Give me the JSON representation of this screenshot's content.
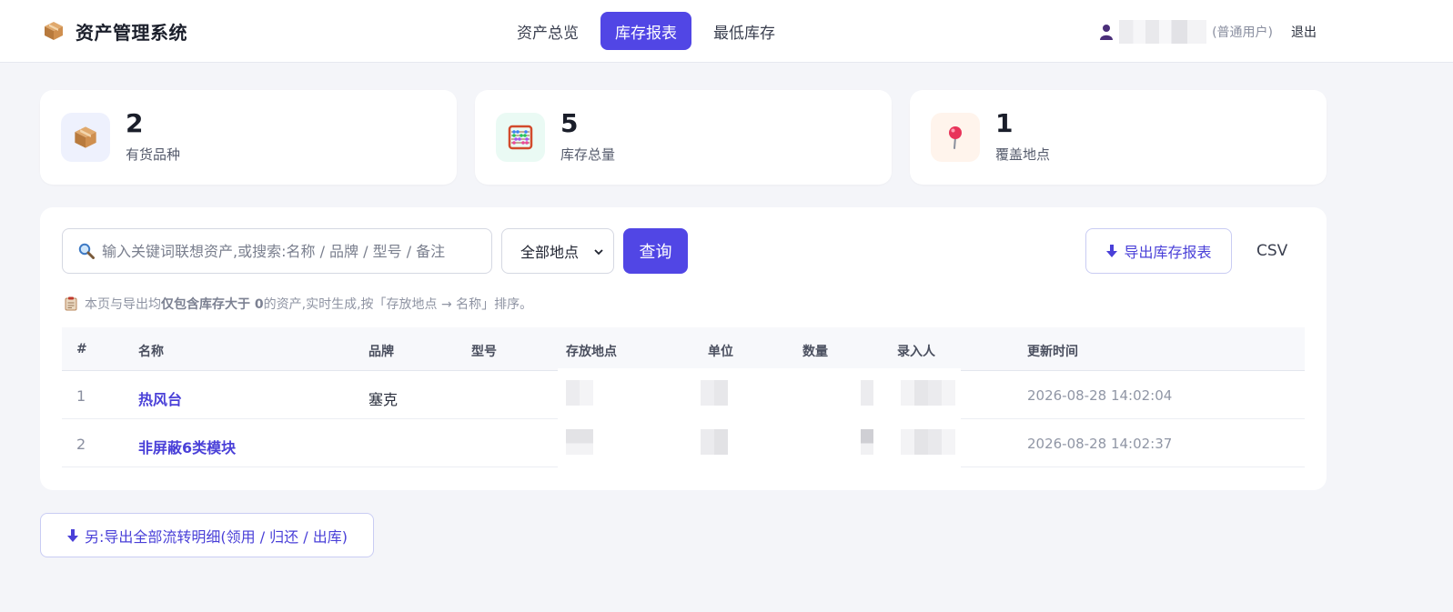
{
  "app": {
    "title": "资产管理系统",
    "icon": "package-icon"
  },
  "nav": {
    "items": [
      {
        "label": "资产总览",
        "active": false
      },
      {
        "label": "库存报表",
        "active": true
      },
      {
        "label": "最低库存",
        "active": false
      }
    ]
  },
  "user": {
    "role": "(普通用户)",
    "logout": "退出"
  },
  "stats": [
    {
      "value": "2",
      "label": "有货品种",
      "icon": "package-icon"
    },
    {
      "value": "5",
      "label": "库存总量",
      "icon": "abacus-icon"
    },
    {
      "value": "1",
      "label": "覆盖地点",
      "icon": "pin-icon"
    }
  ],
  "toolbar": {
    "search_placeholder": "输入关键词联想资产,或搜索:名称 / 品牌 / 型号 / 备注",
    "location_selected": "全部地点",
    "query_label": "查询",
    "export_label": "导出库存报表",
    "csv_label": "CSV"
  },
  "note": {
    "prefix": "本页与导出均",
    "bold": "仅包含库存大于 0",
    "suffix": " 的资产,实时生成,按「存放地点 → 名称」排序。"
  },
  "table": {
    "columns": [
      "#",
      "名称",
      "品牌",
      "型号",
      "存放地点",
      "单位",
      "数量",
      "录入人",
      "更新时间"
    ],
    "rows": [
      {
        "idx": "1",
        "name": "热风台",
        "brand": "塞克",
        "model": "",
        "updated": "2026-08-28 14:02:04"
      },
      {
        "idx": "2",
        "name": "非屏蔽6类模块",
        "brand": "",
        "model": "",
        "updated": "2026-08-28 14:02:37"
      }
    ]
  },
  "footer": {
    "export_all_label": "另:导出全部流转明细(领用 / 归还 / 出库)"
  },
  "colors": {
    "accent": "#5146e5",
    "background": "#f4f5f9"
  }
}
